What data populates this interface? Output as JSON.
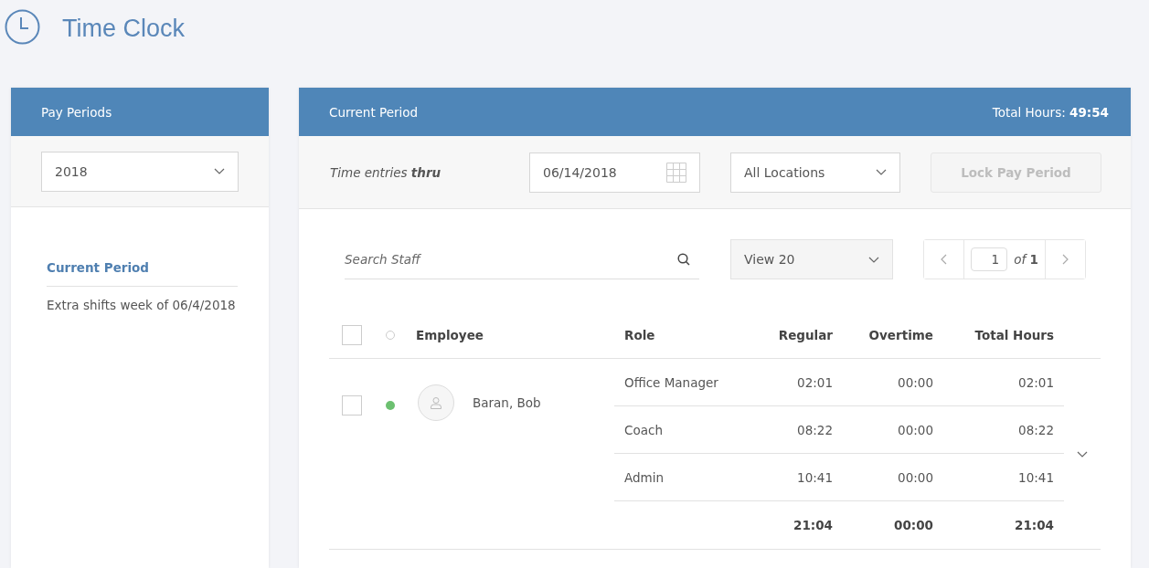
{
  "header": {
    "title": "Time Clock"
  },
  "pay_periods": {
    "title": "Pay Periods",
    "year": "2018",
    "items": [
      {
        "label": "Current Period",
        "selected": true
      },
      {
        "label": "Extra shifts week of 06/4/2018",
        "selected": false
      }
    ]
  },
  "current_period": {
    "title": "Current Period",
    "total_label": "Total Hours:",
    "total_value": "49:54",
    "filter": {
      "label": "Time entries **thru**",
      "date": "06/14/2018",
      "location": "All Locations",
      "lock_button": {
        "label": "Lock Pay Period",
        "disabled": true
      }
    },
    "search": {
      "placeholder": "Search Staff"
    },
    "view": "View 20",
    "pager": {
      "page": "1",
      "of": "of",
      "total": "1"
    },
    "table": {
      "columns": [
        "Employee",
        "Role",
        "Regular",
        "Overtime",
        "Total Hours"
      ],
      "select_all_checked": false,
      "rows": [
        {
          "name": "Baran, Bob",
          "checked": false,
          "online": true,
          "expanded": false,
          "roles": [
            {
              "role": "Office Manager",
              "regular": "02:01",
              "overtime": "00:00",
              "total": "02:01"
            },
            {
              "role": "Coach",
              "regular": "08:22",
              "overtime": "00:00",
              "total": "08:22"
            },
            {
              "role": "Admin",
              "regular": "10:41",
              "overtime": "00:00",
              "total": "10:41"
            }
          ],
          "totals": {
            "regular": "21:04",
            "overtime": "00:00",
            "total": "21:04"
          }
        }
      ]
    }
  }
}
